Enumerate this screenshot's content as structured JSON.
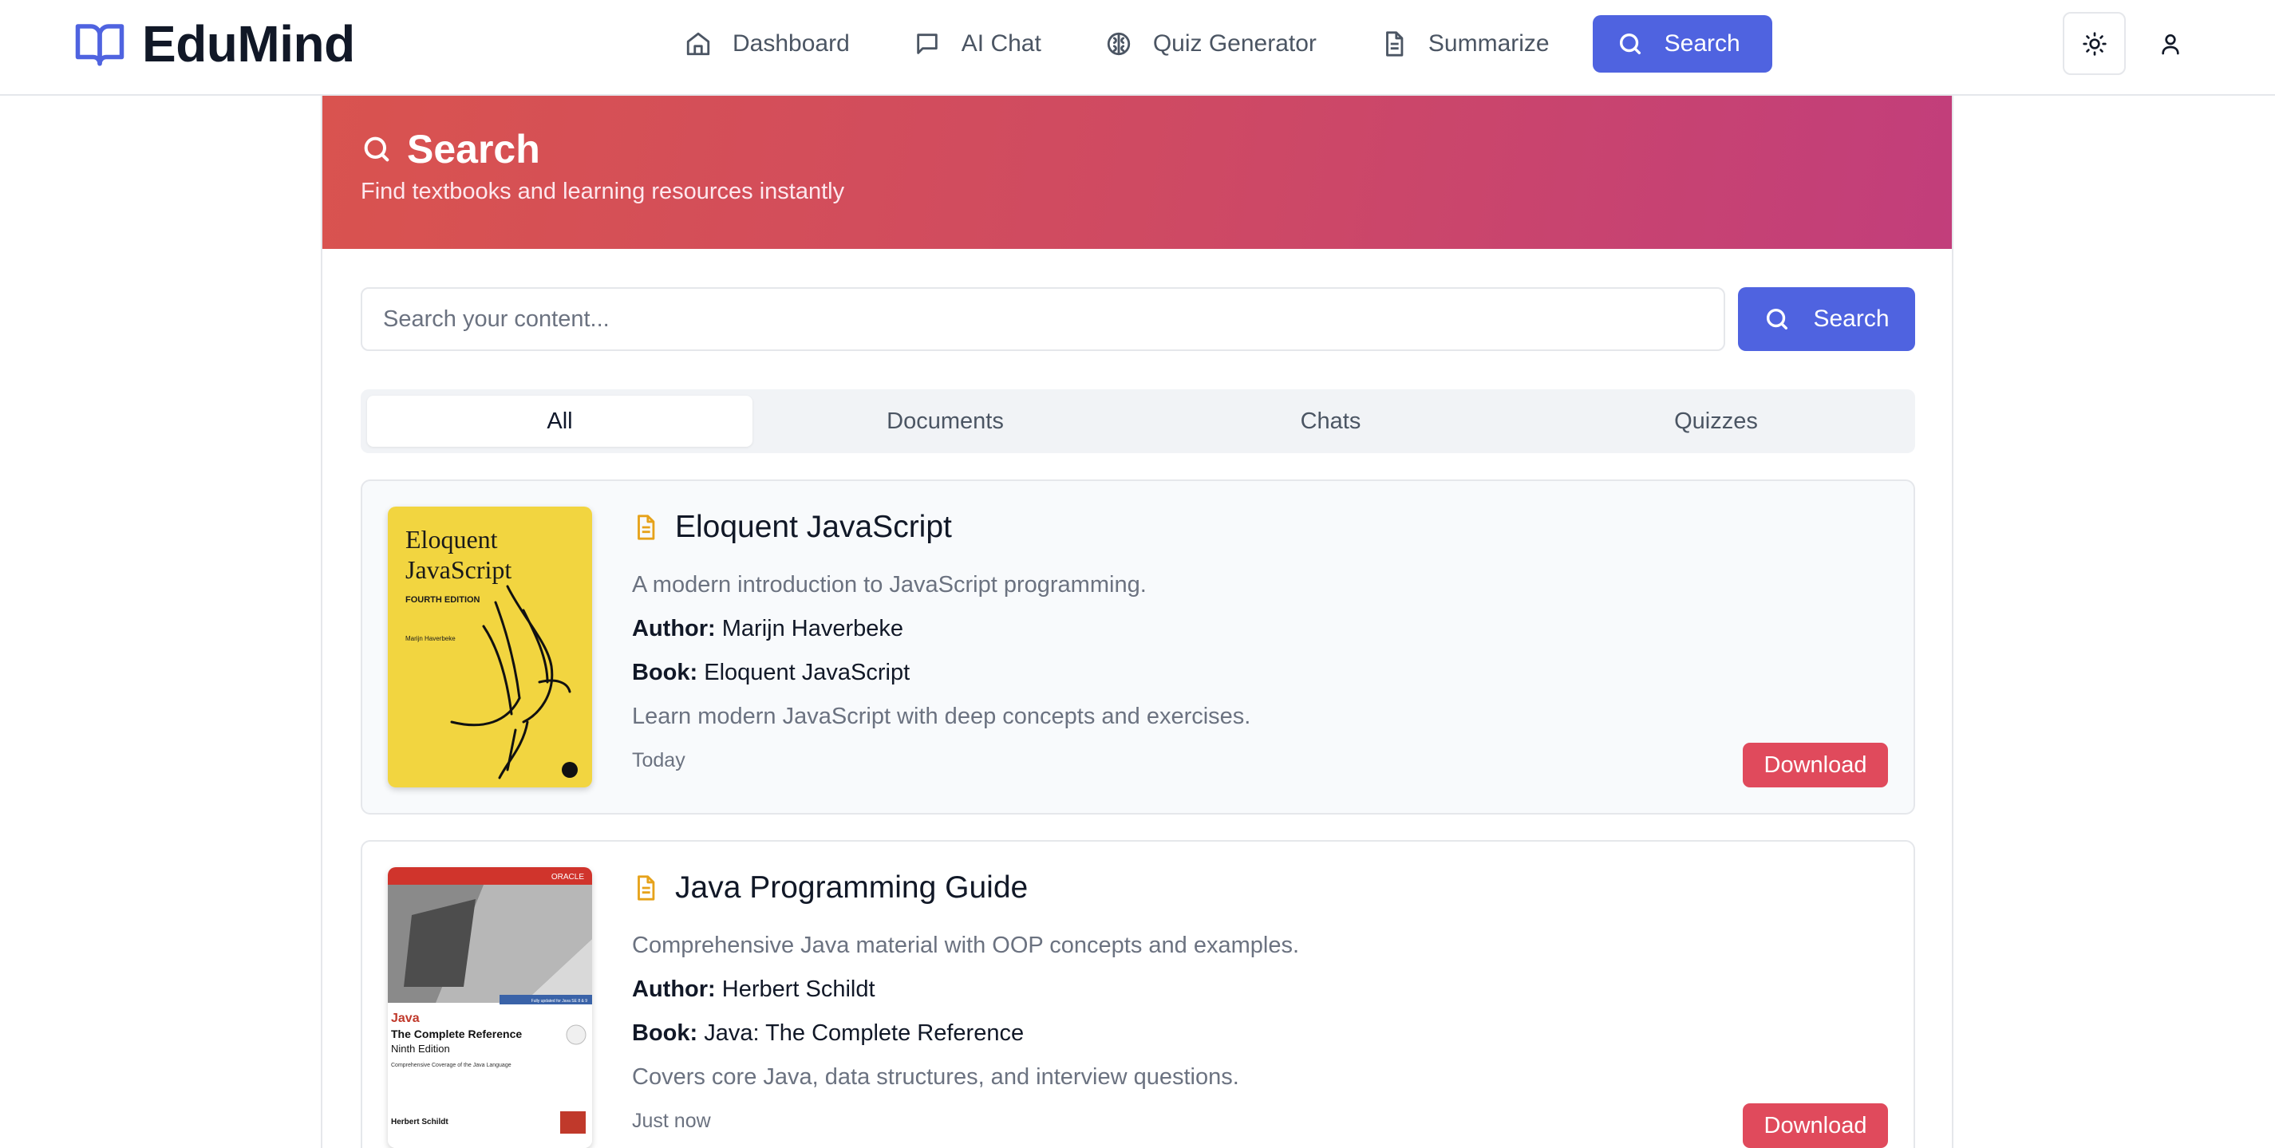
{
  "brand": {
    "name": "EduMind",
    "color": "#4f63e0"
  },
  "nav": {
    "items": [
      {
        "label": "Dashboard",
        "icon": "home-icon"
      },
      {
        "label": "AI Chat",
        "icon": "chat-icon"
      },
      {
        "label": "Quiz Generator",
        "icon": "brain-icon"
      },
      {
        "label": "Summarize",
        "icon": "document-icon"
      },
      {
        "label": "Search",
        "icon": "search-icon",
        "active": true
      }
    ],
    "theme_icon": "sun-icon",
    "user_icon": "user-icon"
  },
  "hero": {
    "title": "Search",
    "subtitle": "Find textbooks and learning resources instantly",
    "gradient": [
      "#d9534f",
      "#c23e7b"
    ]
  },
  "search": {
    "placeholder": "Search your content...",
    "value": "",
    "button_label": "Search"
  },
  "tabs": [
    {
      "label": "All",
      "active": true
    },
    {
      "label": "Documents",
      "active": false
    },
    {
      "label": "Chats",
      "active": false
    },
    {
      "label": "Quizzes",
      "active": false
    }
  ],
  "results": [
    {
      "title": "Eloquent JavaScript",
      "description": "A modern introduction to JavaScript programming.",
      "author_label": "Author:",
      "author": "Marijn Haverbeke",
      "book_label": "Book:",
      "book": "Eloquent JavaScript",
      "extra": "Learn modern JavaScript with deep concepts and exercises.",
      "time": "Today",
      "download_label": "Download",
      "cover": {
        "line1": "Eloquent",
        "line2": "JavaScript",
        "edition": "FOURTH EDITION",
        "author": "Marijn Haverbeke"
      }
    },
    {
      "title": "Java Programming Guide",
      "description": "Comprehensive Java material with OOP concepts and examples.",
      "author_label": "Author:",
      "author": "Herbert Schildt",
      "book_label": "Book:",
      "book": "Java: The Complete Reference",
      "extra": "Covers core Java, data structures, and interview questions.",
      "time": "Just now",
      "download_label": "Download",
      "cover": {
        "brand": "ORACLE",
        "line1": "Java",
        "line2": "The Complete Reference",
        "edition": "Ninth Edition",
        "subtitle": "Comprehensive Coverage of the Java Language",
        "author": "Herbert Schildt",
        "badge": "Fully updated for Java SE 8 & 9"
      }
    }
  ],
  "colors": {
    "accent": "#4f63e0",
    "download": "#e04a5c",
    "doc_icon": "#e6a21a"
  }
}
